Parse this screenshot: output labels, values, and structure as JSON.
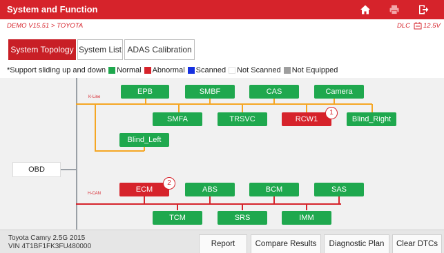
{
  "header": {
    "title": "System and Function",
    "icons": {
      "home": "home-icon",
      "print": "print-icon",
      "exit": "exit-icon"
    }
  },
  "path": {
    "breadcrumb": "DEMO V15.51 > TOYOTA",
    "dlc": "DLC",
    "voltage": "12.5V"
  },
  "tabs": [
    {
      "label": "System Topology",
      "active": true
    },
    {
      "label": "System List",
      "active": false
    },
    {
      "label": "ADAS Calibration",
      "active": false
    }
  ],
  "legend": {
    "note": "*Support sliding up and down",
    "items": [
      {
        "label": "Normal",
        "color": "#1fa84e"
      },
      {
        "label": "Abnormal",
        "color": "#d6232b"
      },
      {
        "label": "Scanned",
        "color": "#1530e0"
      },
      {
        "label": "Not Scanned",
        "color": "#ffffff"
      },
      {
        "label": "Not Equipped",
        "color": "#9e9e9e"
      }
    ]
  },
  "topology": {
    "root": "OBD",
    "kline": {
      "label": "K-Line",
      "color": "#f5a623",
      "row1": [
        "EPB",
        "SMBF",
        "CAS",
        "Camera"
      ],
      "row2": [
        "SMFA",
        "TRSVC",
        "RCW1",
        "Blind_Right"
      ],
      "row3": [
        "Blind_Left"
      ]
    },
    "hcan": {
      "label": "H-CAN",
      "color": "#d6232b",
      "row1": [
        "ECM",
        "ABS",
        "BCM",
        "SAS"
      ],
      "row2": [
        "TCM",
        "SRS",
        "IMM"
      ]
    },
    "abnormal_markers": [
      {
        "module": "RCW1",
        "number": "1"
      },
      {
        "module": "ECM",
        "number": "2"
      }
    ]
  },
  "footer": {
    "vehicle_line1": "Toyota Camry 2.5G 2015",
    "vehicle_line2": "VIN 4T1BF1FK3FU480000",
    "buttons": {
      "report": "Report",
      "compare": "Compare Results",
      "plan": "Diagnostic Plan",
      "clear": "Clear DTCs"
    }
  }
}
